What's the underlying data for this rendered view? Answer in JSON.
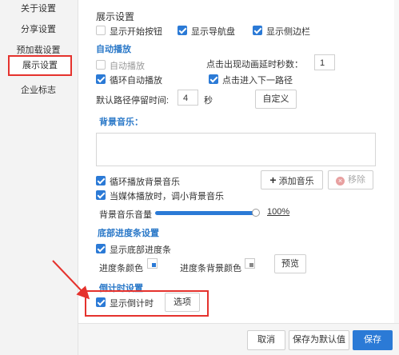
{
  "sidebar": {
    "items": [
      {
        "label": "关于设置"
      },
      {
        "label": "分享设置"
      },
      {
        "label": "预加载设置"
      },
      {
        "label": "展示设置"
      },
      {
        "label": "企业标志"
      }
    ]
  },
  "display": {
    "title": "展示设置",
    "show_start_button": "显示开始按钮",
    "show_navigator": "显示导航盘",
    "show_sidebar": "显示侧边栏"
  },
  "autoplay": {
    "heading": "自动播放",
    "autoplay_label": "自动播放",
    "show_anim_label": "点击出现动画延时秒数：",
    "show_anim_value": "1",
    "loop_label": "循环自动播放",
    "next_path_label": "点击进入下一路径",
    "dwell_label": "默认路径停留时间:",
    "dwell_value": "4",
    "dwell_unit": "秒",
    "custom_button": "自定义"
  },
  "music": {
    "heading": "背景音乐：",
    "loop_label": "循环播放背景音乐",
    "add_button": "添加音乐",
    "remove_button": "移除",
    "lower_label": "当媒体播放时，调小背景音乐",
    "volume_label": "背景音乐音量",
    "volume_value": "100%",
    "volume_fraction": 1.0
  },
  "progress": {
    "heading": "底部进度条设置",
    "show_label": "显示底部进度条",
    "color_label": "进度条颜色",
    "bg_color_label": "进度条背景颜色",
    "preview_button": "预览",
    "color": "#2b7ad6",
    "bg_color": "#888888"
  },
  "countdown": {
    "heading": "倒计时设置",
    "show_label": "显示倒计时",
    "options_button": "选项"
  },
  "footer": {
    "cancel": "取消",
    "save_default": "保存为默认值",
    "save": "保存"
  },
  "colors": {
    "accent": "#2b7ad6",
    "highlight": "#e5322d"
  }
}
